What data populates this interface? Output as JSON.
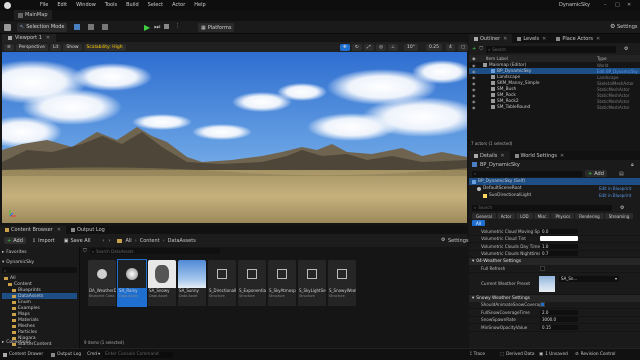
{
  "window": {
    "project_name": "DynamicSky",
    "level_name": "MainMap"
  },
  "menu": [
    "File",
    "Edit",
    "Window",
    "Tools",
    "Build",
    "Select",
    "Actor",
    "Help"
  ],
  "toolbar": {
    "mode": "Selection Mode",
    "platforms": "Platforms"
  },
  "viewport": {
    "tab": "Viewport 1",
    "perspective": "Perspective",
    "lit": "Lit",
    "show": "Show",
    "scalability": "Scalability: High",
    "fov": "10°",
    "scale": "0.25",
    "speed": "4"
  },
  "content_browser": {
    "tab": "Content Browser",
    "tab2": "Output Log",
    "add": "Add",
    "import": "Import",
    "save_all": "Save All",
    "path": [
      "All",
      "Content",
      "DataAssets"
    ],
    "settings": "Settings",
    "search_placeholder": "Search DataAssets",
    "favorites": "Favorites",
    "root": "DynamicSky",
    "tree": [
      "All",
      "Content",
      "Blueprints",
      "DataAssets",
      "Enum",
      "Examples",
      "Maps",
      "Materials",
      "Meshes",
      "Particles",
      "Niagara",
      "StarterContent",
      "Textures"
    ],
    "collections": "Collections",
    "status": "9 items (1 selected)",
    "assets": [
      {
        "name": "DA_WeatherDataAssetBase",
        "label": "DA_WeatherDataAssetBase",
        "sub": "Blueprint Class"
      },
      {
        "name": "SA_Rainy",
        "label": "SA_Rainy",
        "sub": "Data Asset"
      },
      {
        "name": "SA_Snowy",
        "label": "SA_Snowy",
        "sub": "Data Asset"
      },
      {
        "name": "SA_Sunny",
        "label": "SA_Sunny",
        "sub": "Data Asset"
      },
      {
        "name": "S_DirectionalLightSettings",
        "label": "S_DirectionalLightSettings",
        "sub": "Structure"
      },
      {
        "name": "S_ExponentialHeightFog",
        "label": "S_ExponentialHeightFog",
        "sub": "Structure"
      },
      {
        "name": "S_SkyAtmosphere",
        "label": "S_SkyAtmosphere",
        "sub": "Structure"
      },
      {
        "name": "S_SkyLightSettings",
        "label": "S_SkyLightSettings",
        "sub": "Structure"
      },
      {
        "name": "S_SnowyWeatherSettings",
        "label": "S_SnowyWeatherSettings",
        "sub": "Structure"
      }
    ]
  },
  "statusbar": {
    "drawer": "Content Drawer",
    "output": "Output Log",
    "cmd": "Cmd",
    "cmd_placeholder": "Enter Console Command",
    "trace": "Trace",
    "derived": "Derived Data",
    "unsaved": "1 Unsaved",
    "revision": "Revision Control"
  },
  "outliner": {
    "tab": "Outliner",
    "tab2": "Levels",
    "tab3": "Place Actors",
    "search_placeholder": "Search",
    "col_label": "Item Label",
    "col_type": "Type",
    "rows": [
      {
        "label": "Mainmap (Editor)",
        "type": "World"
      },
      {
        "label": "BP_DynamicSky",
        "type": "Edit BP_DynamicSky"
      },
      {
        "label": "Landscape",
        "type": "Landscape"
      },
      {
        "label": "SKM_Manny_Simple",
        "type": "SkeletalMeshActor"
      },
      {
        "label": "SM_Bush",
        "type": "StaticMeshActor"
      },
      {
        "label": "SM_Rock",
        "type": "StaticMeshActor"
      },
      {
        "label": "SM_Rock2",
        "type": "StaticMeshActor"
      },
      {
        "label": "SM_TableRound",
        "type": "StaticMeshActor"
      }
    ],
    "footer": "7 actors (1 selected)"
  },
  "details": {
    "tab": "Details",
    "tab2": "World Settings",
    "actor": "BP_DynamicSky",
    "add": "Add",
    "root": "BP_DynamicSky (Self)",
    "comp1": "DefaultSceneRoot",
    "comp2": "SunDirectionalLight",
    "edit_bp": "Edit in Blueprint",
    "search_placeholder": "Search",
    "filters": [
      "General",
      "Actor",
      "LOD",
      "Misc",
      "Physics",
      "Rendering",
      "Streaming",
      "All"
    ],
    "props_a": [
      {
        "label": "Volumetric Cloud Moving Speed",
        "value": "0.0"
      },
      {
        "label": "Volumetric Cloud Tint",
        "value": ""
      },
      {
        "label": "Volumetric Clouds Day Time Brightness",
        "value": "1.0"
      },
      {
        "label": "Volumetric Clouds Nighttime Brightness",
        "value": "0.7"
      }
    ],
    "section_weather": "04-Weather Settings",
    "full_refresh": "Full Refresh",
    "current_preset": "Current Weather Preset",
    "preset_value": "SA_Sn...",
    "section_snowy": "Snowy Weather Settings",
    "props_b": [
      {
        "label": "ShouldAnimateSnowCoverage",
        "value": ""
      },
      {
        "label": "FullSnowCoverageTime",
        "value": "2.0"
      },
      {
        "label": "SnowSpawnRate",
        "value": "3000.0"
      },
      {
        "label": "MinSnowOpacityValue",
        "value": "0.15"
      }
    ]
  },
  "colors": {
    "accent": "#1f6fd1",
    "selected_row": "#1d4f86",
    "bg": "#151515"
  }
}
